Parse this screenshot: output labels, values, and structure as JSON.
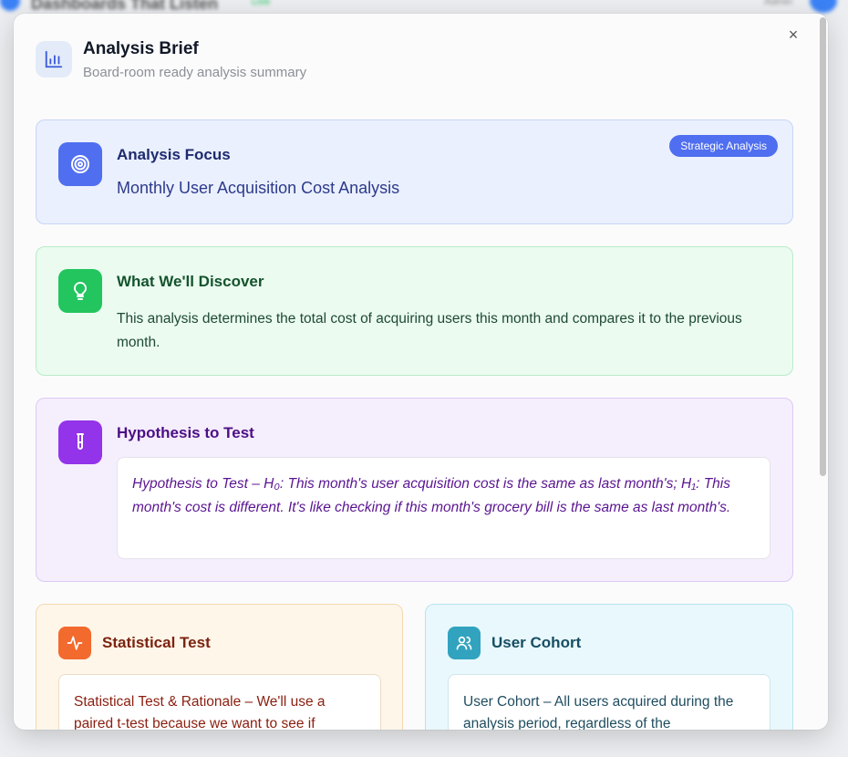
{
  "background": {
    "title": "Dashboards That Listen",
    "live": "Live",
    "user": "Admin"
  },
  "modal": {
    "title": "Analysis Brief",
    "subtitle": "Board-room ready analysis summary",
    "close_label": "×"
  },
  "focus": {
    "title": "Analysis Focus",
    "badge": "Strategic Analysis",
    "value": "Monthly User Acquisition Cost Analysis"
  },
  "discover": {
    "title": "What We'll Discover",
    "text": "This analysis determines the total cost of acquiring users this month and compares it to the previous month."
  },
  "hypothesis": {
    "title": "Hypothesis to Test",
    "text": "Hypothesis to Test – H₀: This month's user acquisition cost is the same as last month's; H₁: This month's cost is different. It's like checking if this month's grocery bill is the same as last month's."
  },
  "statistical": {
    "title": "Statistical Test",
    "text": "Statistical Test & Rationale – We'll use a paired t-test because we want to see if"
  },
  "cohort": {
    "title": "User Cohort",
    "text": "User Cohort – All users acquired during the analysis period, regardless of the"
  },
  "colors": {
    "focus_accent": "#4f6ef0",
    "discover_accent": "#22c55e",
    "hypothesis_accent": "#9333ea",
    "statistical_accent": "#f26a2e",
    "cohort_accent": "#31a3bf"
  },
  "icons": {
    "header": "bar-chart-icon",
    "focus": "target-icon",
    "discover": "lightbulb-icon",
    "hypothesis": "test-tube-icon",
    "statistical": "activity-icon",
    "cohort": "users-icon",
    "close": "close-icon"
  }
}
